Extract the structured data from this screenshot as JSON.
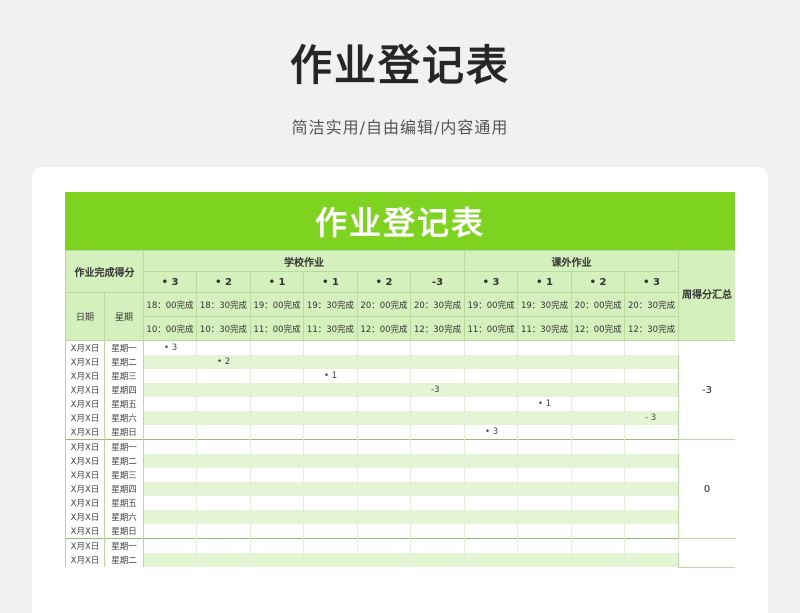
{
  "page": {
    "title": "作业登记表",
    "subtitle": "简洁实用/自由编辑/内容通用"
  },
  "sheet": {
    "banner": "作业登记表",
    "corner_label": "作业完成得分",
    "date_header": "日期",
    "day_header": "星期",
    "group_school": "学校作业",
    "group_extra": "课外作业",
    "weekly_header": "周得分汇总",
    "scores": [
      "• 3",
      "• 2",
      "• 1",
      "• 1",
      "• 2",
      "-3",
      "• 3",
      "• 1",
      "• 2",
      "• 3"
    ],
    "times_row1": [
      "18：00完成",
      "18：30完成",
      "19：00完成",
      "19：30完成",
      "20：00完成",
      "20：30完成",
      "19：00完成",
      "19：30完成",
      "20：00完成",
      "20：30完成"
    ],
    "times_row2": [
      "10：00完成",
      "10：30完成",
      "11：00完成",
      "11：30完成",
      "12：00完成",
      "12：30完成",
      "11：00完成",
      "11：30完成",
      "12：00完成",
      "12：30完成"
    ],
    "weeks": [
      {
        "total": "-3",
        "rows": [
          {
            "date": "X月X日",
            "day": "星期一",
            "cells": [
              "• 3",
              "",
              "",
              "",
              "",
              "",
              "",
              "",
              "",
              ""
            ]
          },
          {
            "date": "X月X日",
            "day": "星期二",
            "cells": [
              "",
              "• 2",
              "",
              "",
              "",
              "",
              "",
              "",
              "",
              ""
            ]
          },
          {
            "date": "X月X日",
            "day": "星期三",
            "cells": [
              "",
              "",
              "",
              "• 1",
              "",
              "",
              "",
              "",
              "",
              ""
            ]
          },
          {
            "date": "X月X日",
            "day": "星期四",
            "cells": [
              "",
              "",
              "",
              "",
              "",
              "-3",
              "",
              "",
              "",
              ""
            ]
          },
          {
            "date": "X月X日",
            "day": "星期五",
            "cells": [
              "",
              "",
              "",
              "",
              "",
              "",
              "",
              "• 1",
              "",
              ""
            ]
          },
          {
            "date": "X月X日",
            "day": "星期六",
            "cells": [
              "",
              "",
              "",
              "",
              "",
              "",
              "",
              "",
              "",
              "- 3"
            ]
          },
          {
            "date": "X月X日",
            "day": "星期日",
            "cells": [
              "",
              "",
              "",
              "",
              "",
              "",
              "• 3",
              "",
              "",
              ""
            ]
          }
        ]
      },
      {
        "total": "0",
        "rows": [
          {
            "date": "X月X日",
            "day": "星期一",
            "cells": [
              "",
              "",
              "",
              "",
              "",
              "",
              "",
              "",
              "",
              ""
            ]
          },
          {
            "date": "X月X日",
            "day": "星期二",
            "cells": [
              "",
              "",
              "",
              "",
              "",
              "",
              "",
              "",
              "",
              ""
            ]
          },
          {
            "date": "X月X日",
            "day": "星期三",
            "cells": [
              "",
              "",
              "",
              "",
              "",
              "",
              "",
              "",
              "",
              ""
            ]
          },
          {
            "date": "X月X日",
            "day": "星期四",
            "cells": [
              "",
              "",
              "",
              "",
              "",
              "",
              "",
              "",
              "",
              ""
            ]
          },
          {
            "date": "X月X日",
            "day": "星期五",
            "cells": [
              "",
              "",
              "",
              "",
              "",
              "",
              "",
              "",
              "",
              ""
            ]
          },
          {
            "date": "X月X日",
            "day": "星期六",
            "cells": [
              "",
              "",
              "",
              "",
              "",
              "",
              "",
              "",
              "",
              ""
            ]
          },
          {
            "date": "X月X日",
            "day": "星期日",
            "cells": [
              "",
              "",
              "",
              "",
              "",
              "",
              "",
              "",
              "",
              ""
            ]
          }
        ]
      },
      {
        "total": "",
        "rows": [
          {
            "date": "X月X日",
            "day": "星期一",
            "cells": [
              "",
              "",
              "",
              "",
              "",
              "",
              "",
              "",
              "",
              ""
            ]
          },
          {
            "date": "X月X日",
            "day": "星期二",
            "cells": [
              "",
              "",
              "",
              "",
              "",
              "",
              "",
              "",
              "",
              ""
            ]
          }
        ]
      }
    ]
  }
}
